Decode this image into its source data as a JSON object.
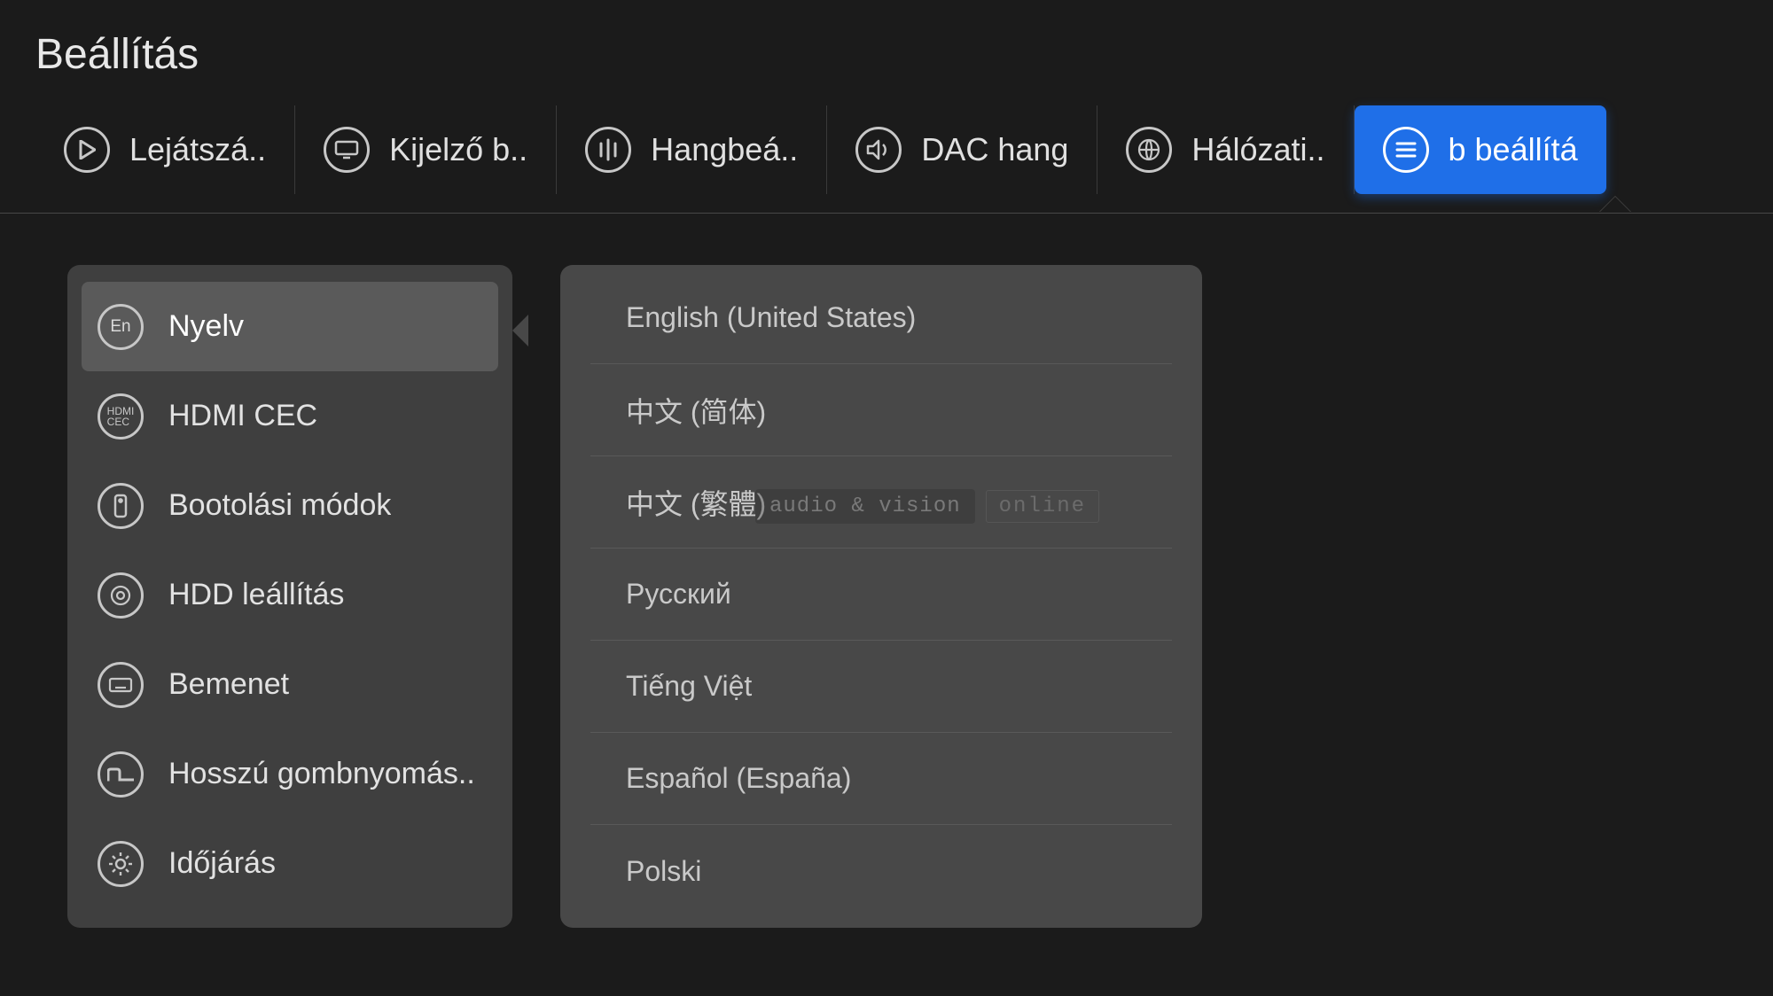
{
  "title": "Beállítás",
  "tabs": [
    {
      "id": "play",
      "label": "Lejátszá.."
    },
    {
      "id": "display",
      "label": "Kijelző b.."
    },
    {
      "id": "audio",
      "label": "Hangbeá.."
    },
    {
      "id": "dac",
      "label": "DAC hang"
    },
    {
      "id": "network",
      "label": "Hálózati.."
    },
    {
      "id": "other",
      "label": "b beállítá",
      "active": true
    }
  ],
  "side": [
    {
      "icon": "language",
      "label": "Nyelv",
      "selected": true
    },
    {
      "icon": "hdmi-cec",
      "label": "HDMI CEC"
    },
    {
      "icon": "boot",
      "label": "Bootolási módok"
    },
    {
      "icon": "hdd",
      "label": "HDD leállítás"
    },
    {
      "icon": "input",
      "label": "Bemenet"
    },
    {
      "icon": "longpress",
      "label": "Hosszú gombnyomás.."
    },
    {
      "icon": "weather",
      "label": "Időjárás"
    }
  ],
  "languages": [
    "English (United States)",
    "中文 (简体)",
    "中文 (繁體)",
    "Русский",
    "Tiếng Việt",
    "Español (España)",
    "Polski"
  ],
  "watermark": {
    "left": "audio & vision",
    "right": "online"
  },
  "icons": {
    "play": "play-icon",
    "display": "display-icon",
    "audio": "equalizer-icon",
    "dac": "volume-icon",
    "network": "globe-icon",
    "other": "menu-icon",
    "language": "language-en-icon",
    "hdmi-cec": "hdmi-cec-icon",
    "boot": "boot-icon",
    "hdd": "hdd-icon",
    "input": "keyboard-icon",
    "longpress": "longpress-icon",
    "weather": "brightness-icon"
  }
}
